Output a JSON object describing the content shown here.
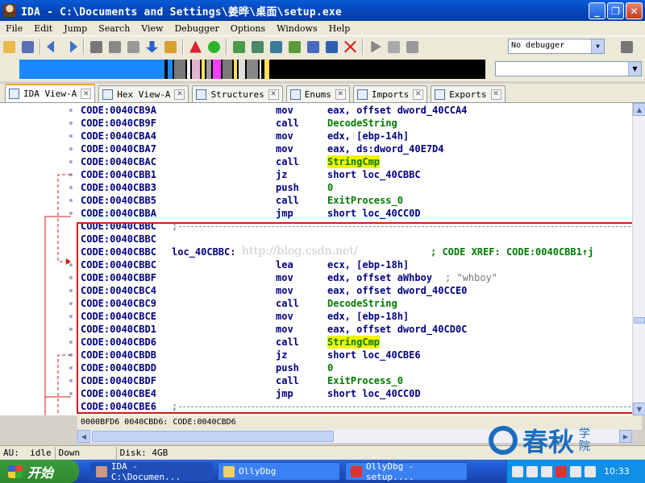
{
  "window": {
    "title": "IDA - C:\\Documents and Settings\\姜晔\\桌面\\setup.exe"
  },
  "menu": [
    "File",
    "Edit",
    "Jump",
    "Search",
    "View",
    "Debugger",
    "Options",
    "Windows",
    "Help"
  ],
  "toolbar": {
    "debugger_select": "No debugger"
  },
  "tabs": [
    "IDA View-A",
    "Hex View-A",
    "Structures",
    "Enums",
    "Imports",
    "Exports"
  ],
  "disasm": {
    "rows": [
      {
        "addr": "CODE:0040CB9A",
        "label": "",
        "op": "mov",
        "args": "eax, offset dword_40CCA4",
        "comment": ""
      },
      {
        "addr": "CODE:0040CB9F",
        "label": "",
        "op": "call",
        "args": "DecodeString",
        "comment": ""
      },
      {
        "addr": "CODE:0040CBA4",
        "label": "",
        "op": "mov",
        "args": "edx, [ebp-14h]",
        "comment": ""
      },
      {
        "addr": "CODE:0040CBA7",
        "label": "",
        "op": "mov",
        "args": "eax, ds:dword_40E7D4",
        "comment": ""
      },
      {
        "addr": "CODE:0040CBAC",
        "label": "",
        "op": "call",
        "args": "StringCmp",
        "comment": ""
      },
      {
        "addr": "CODE:0040CBB1",
        "label": "",
        "op": "jz",
        "args": "short loc_40CBBC",
        "comment": ""
      },
      {
        "addr": "CODE:0040CBB3",
        "label": "",
        "op": "push",
        "args": "0",
        "comment": ""
      },
      {
        "addr": "CODE:0040CBB5",
        "label": "",
        "op": "call",
        "args": "ExitProcess_0",
        "comment": ""
      },
      {
        "addr": "CODE:0040CBBA",
        "label": "",
        "op": "jmp",
        "args": "short loc_40CC0D",
        "comment": ""
      },
      {
        "addr": "CODE:0040CBBC",
        "label": "",
        "op": "",
        "args": "",
        "comment": ";"
      },
      {
        "addr": "CODE:0040CBBC",
        "label": "",
        "op": "",
        "args": "",
        "comment": ""
      },
      {
        "addr": "CODE:0040CBBC",
        "label": "loc_40CBBC:",
        "op": "",
        "args": "",
        "comment": "; CODE XREF: CODE:0040CBB1↑j"
      },
      {
        "addr": "CODE:0040CBBC",
        "label": "",
        "op": "lea",
        "args": "ecx, [ebp-18h]",
        "comment": ""
      },
      {
        "addr": "CODE:0040CBBF",
        "label": "",
        "op": "mov",
        "args": "edx, offset aWhboy",
        "comment": "; \"whboy\""
      },
      {
        "addr": "CODE:0040CBC4",
        "label": "",
        "op": "mov",
        "args": "eax, offset dword_40CCE0",
        "comment": ""
      },
      {
        "addr": "CODE:0040CBC9",
        "label": "",
        "op": "call",
        "args": "DecodeString",
        "comment": ""
      },
      {
        "addr": "CODE:0040CBCE",
        "label": "",
        "op": "mov",
        "args": "edx, [ebp-18h]",
        "comment": ""
      },
      {
        "addr": "CODE:0040CBD1",
        "label": "",
        "op": "mov",
        "args": "eax, offset dword_40CD0C",
        "comment": ""
      },
      {
        "addr": "CODE:0040CBD6",
        "label": "",
        "op": "call",
        "args": "StringCmp",
        "comment": ""
      },
      {
        "addr": "CODE:0040CBDB",
        "label": "",
        "op": "jz",
        "args": "short loc_40CBE6",
        "comment": ""
      },
      {
        "addr": "CODE:0040CBDD",
        "label": "",
        "op": "push",
        "args": "0",
        "comment": ""
      },
      {
        "addr": "CODE:0040CBDF",
        "label": "",
        "op": "call",
        "args": "ExitProcess_0",
        "comment": ""
      },
      {
        "addr": "CODE:0040CBE4",
        "label": "",
        "op": "jmp",
        "args": "short loc_40CC0D",
        "comment": ""
      },
      {
        "addr": "CODE:0040CBE6",
        "label": "",
        "op": "",
        "args": "",
        "comment": ";"
      }
    ],
    "watermark": "http://blog.csdn.net/"
  },
  "position_line": "0000BFD6 0040CBD6: CODE:0040CBD6",
  "status": {
    "au": "AU:",
    "state": "idle",
    "dir": "Down",
    "disk": "Disk: 4GB"
  },
  "logo": {
    "text": "春秋",
    "small": "学院"
  },
  "taskbar": {
    "start": "开始",
    "tasks": [
      "IDA - C:\\Documen...",
      "OllyDbg",
      "OllyDbg - setup...."
    ],
    "clock": "10:33"
  }
}
